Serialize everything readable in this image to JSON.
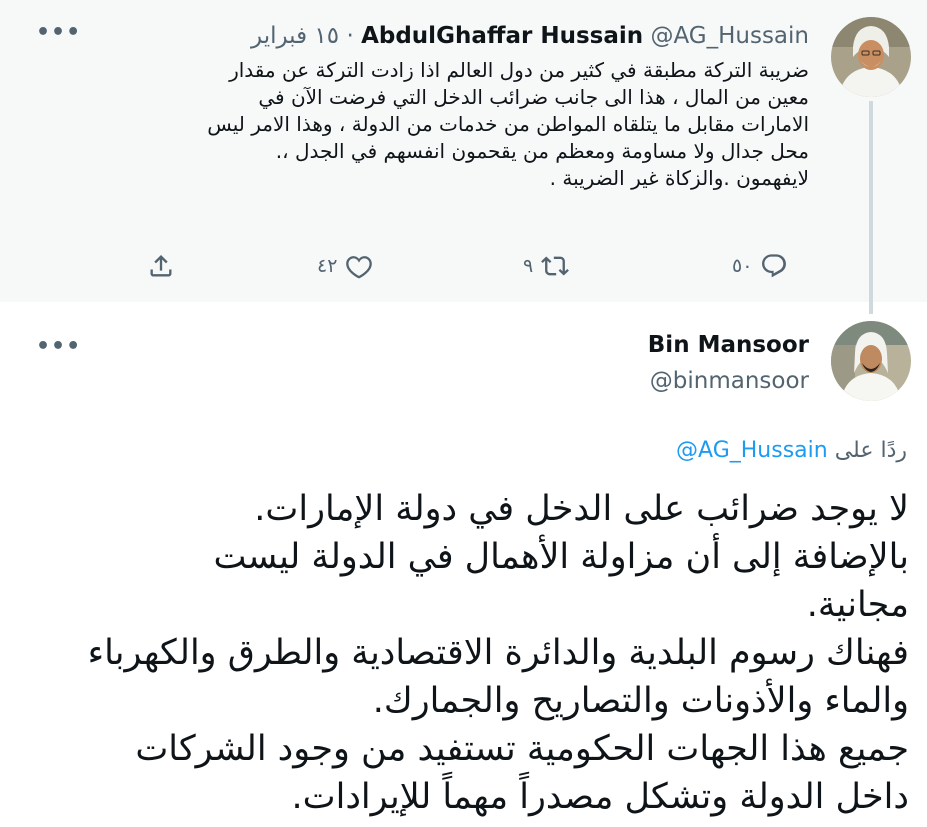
{
  "parent_tweet": {
    "author_name": "AbdulGhaffar Hussain",
    "author_handle": "@AG_Hussain",
    "separator": "·",
    "date": "١٥ فبراير",
    "text": "ضريبة التركة مطبقة في كثير من دول العالم اذا زادت التركة عن مقدار\nمعين من المال ، هذا الى جانب ضرائب الدخل التي فرضت الآن في\nالامارات مقابل ما يتلقاه المواطن من خدمات من الدولة ، وهذا الامر ليس\nمحل جدال ولا مساومة ومعظم من يقحمون انفسهم في الجدل ،.\nلايفهمون .والزكاة غير الضريبة .",
    "counts": {
      "replies": "٥٠",
      "retweets": "٩",
      "likes": "٤٢"
    },
    "more_label": "•••"
  },
  "main_tweet": {
    "author_name": "Bin Mansoor",
    "author_handle": "@binmansoor",
    "replying_to_label": "ردًا على",
    "replying_to_handle": "@AG_Hussain",
    "text": "لا يوجد ضرائب على الدخل في دولة الإمارات.\nبالإضافة إلى أن مزاولة الأهمال في الدولة ليست\nمجانية.\nفهناك رسوم البلدية والدائرة الاقتصادية والطرق والكهرباء\nوالماء والأذونات والتصاريح والجمارك.\nجميع هذا الجهات الحكومية تستفيد من وجود الشركات\nداخل الدولة وتشكل مصدراً مهماً للإيرادات.",
    "more_label": "•••"
  },
  "icons": {
    "reply": "reply-bubble-icon",
    "retweet": "retweet-arrows-icon",
    "like": "heart-outline-icon",
    "share": "share-upload-icon",
    "more": "more-dots-icon"
  },
  "colors": {
    "parent_bg": "#f7f9f9",
    "text_primary": "#0f1419",
    "text_secondary": "#536471",
    "link": "#1d9bf0",
    "thread_line": "#cfd9de"
  }
}
